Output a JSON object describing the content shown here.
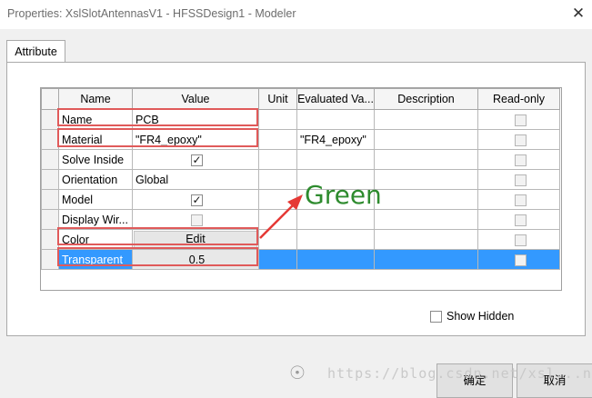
{
  "window": {
    "title": "Properties: XslSlotAntennasV1 - HFSSDesign1 - Modeler",
    "close_glyph": "✕"
  },
  "tabs": [
    {
      "label": "Attribute"
    }
  ],
  "table": {
    "headers": {
      "name": "Name",
      "value": "Value",
      "unit": "Unit",
      "evaluated": "Evaluated Va...",
      "description": "Description",
      "readonly": "Read-only"
    },
    "rows": [
      {
        "name": "Name",
        "value": "PCB",
        "unit": "",
        "evaluated": "",
        "description": ""
      },
      {
        "name": "Material",
        "value": "\"FR4_epoxy\"",
        "unit": "",
        "evaluated": "\"FR4_epoxy\"",
        "description": ""
      },
      {
        "name": "Solve Inside",
        "value_checked": true,
        "unit": "",
        "evaluated": "",
        "description": ""
      },
      {
        "name": "Orientation",
        "value": "Global",
        "unit": "",
        "evaluated": "",
        "description": ""
      },
      {
        "name": "Model",
        "value_checked": true,
        "unit": "",
        "evaluated": "",
        "description": ""
      },
      {
        "name": "Display Wir...",
        "value_checked": false,
        "unit": "",
        "evaluated": "",
        "description": ""
      },
      {
        "name": "Color",
        "value": "Edit",
        "unit": "",
        "evaluated": "",
        "description": ""
      },
      {
        "name": "Transparent",
        "value": "0.5",
        "unit": "",
        "evaluated": "",
        "description": ""
      }
    ],
    "selected_row": "Transparent",
    "check_glyph": "✓",
    "colors": {
      "selection": "#3399ff",
      "highlight_box": "#e05a5a"
    }
  },
  "annotation": {
    "text": "Green",
    "color": "#2e8b2e",
    "arrow_color": "#e53935"
  },
  "show_hidden": {
    "label": "Show Hidden",
    "checked": false
  },
  "footer": {
    "ok_label": "确定",
    "cancel_label": "取消"
  },
  "watermark": {
    "text": "https://blog.csdn.net/xsl...n"
  }
}
